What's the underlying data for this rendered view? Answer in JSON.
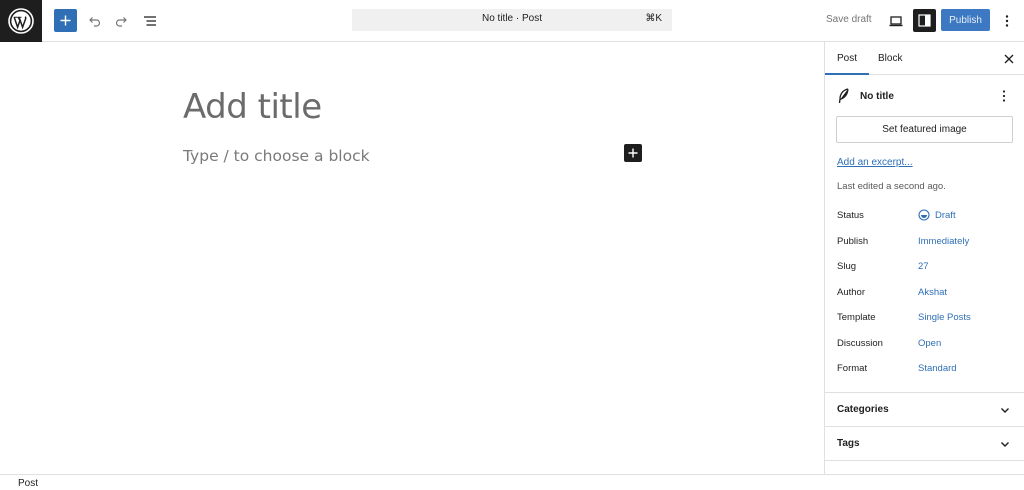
{
  "toolbar": {
    "logo_icon": "wordpress-icon",
    "add_block_icon": "plus-icon",
    "undo_icon": "undo-icon",
    "redo_icon": "redo-icon",
    "document_overview_icon": "list-view-icon",
    "command_title": "No title · Post",
    "command_shortcut": "⌘K",
    "save_draft_label": "Save draft",
    "preview_icon": "desktop-icon",
    "settings_icon": "sidebar-toggle-icon",
    "publish_label": "Publish",
    "options_icon": "more-vertical-icon"
  },
  "editor": {
    "title_placeholder": "Add title",
    "block_placeholder": "Type / to choose a block",
    "inserter_icon": "plus-icon"
  },
  "sidebar": {
    "tabs": [
      {
        "label": "Post",
        "active": true
      },
      {
        "label": "Block",
        "active": false
      }
    ],
    "close_icon": "close-icon",
    "post_icon": "feather-icon",
    "post_title": "No title",
    "post_options_icon": "more-vertical-icon",
    "featured_image_label": "Set featured image",
    "excerpt_link": "Add an excerpt...",
    "last_edited": "Last edited a second ago.",
    "meta": [
      {
        "label": "Status",
        "value": "Draft"
      },
      {
        "label": "Publish",
        "value": "Immediately"
      },
      {
        "label": "Slug",
        "value": "27"
      },
      {
        "label": "Author",
        "value": "Akshat"
      },
      {
        "label": "Template",
        "value": "Single Posts"
      },
      {
        "label": "Discussion",
        "value": "Open"
      },
      {
        "label": "Format",
        "value": "Standard"
      }
    ],
    "panels": [
      {
        "label": "Categories",
        "icon": "chevron-down-icon"
      },
      {
        "label": "Tags",
        "icon": "chevron-down-icon"
      }
    ]
  },
  "footer": {
    "breadcrumb": "Post"
  },
  "colors": {
    "accent": "#2f6fb6",
    "dark": "#1e1e1e",
    "border": "#e0e0e0"
  }
}
